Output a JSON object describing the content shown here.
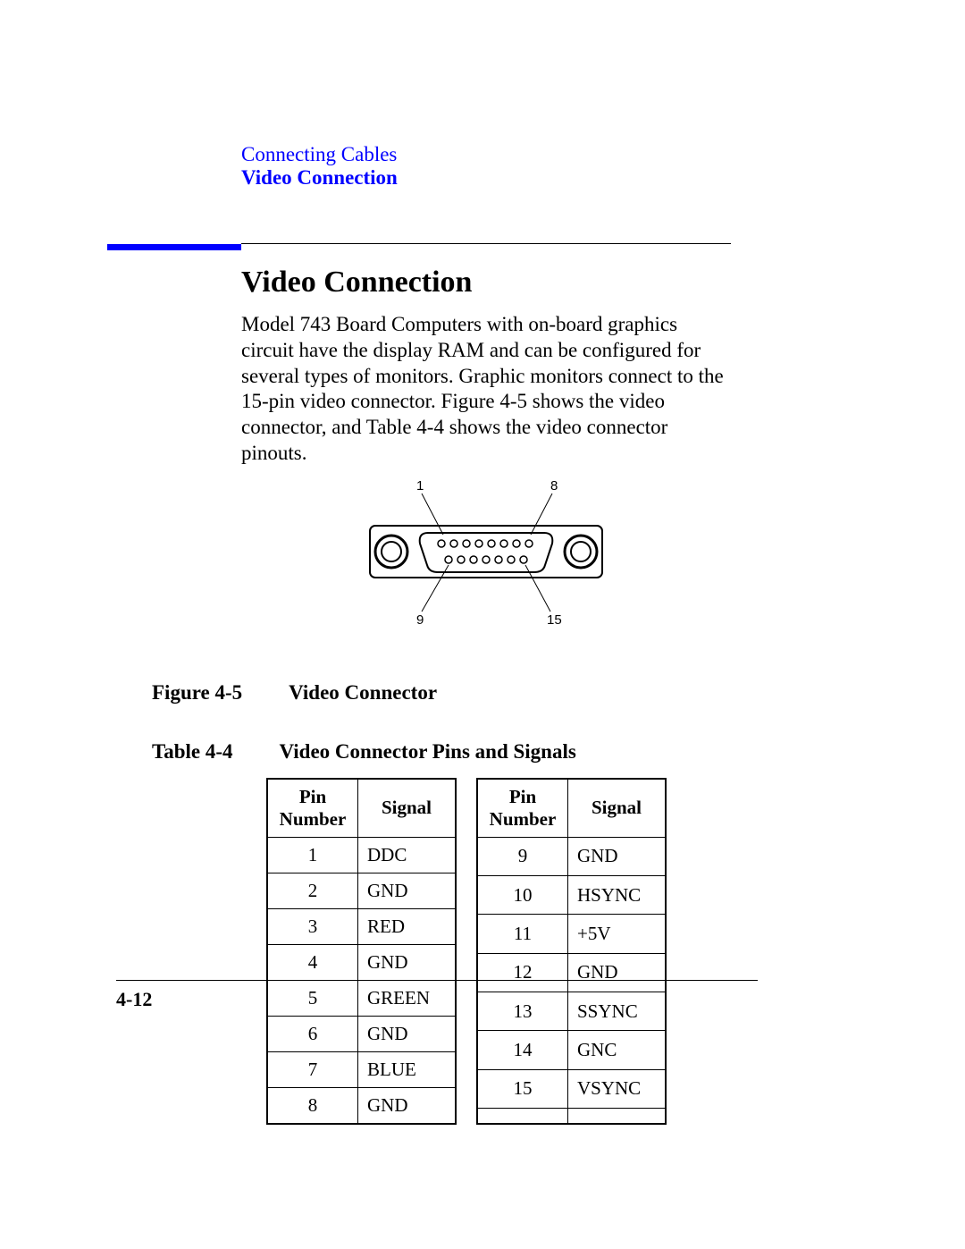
{
  "header": {
    "chapter": "Connecting Cables",
    "section": "Video Connection"
  },
  "title": "Video Connection",
  "paragraph": "Model 743 Board Computers with on-board graphics circuit have the display RAM and can be configured for several types of monitors. Graphic monitors connect to the 15-pin video connector. Figure 4-5 shows the video connector, and Table 4-4 shows the video connector pinouts.",
  "figure": {
    "label": "Figure 4-5",
    "caption": "Video Connector",
    "pin_labels": {
      "top_left": "1",
      "top_right": "8",
      "bottom_left": "9",
      "bottom_right": "15"
    }
  },
  "table": {
    "label": "Table 4-4",
    "caption": "Video Connector Pins and Signals",
    "headers": {
      "pin": "Pin Number",
      "signal": "Signal"
    },
    "left_rows": [
      {
        "pin": "1",
        "signal": "DDC"
      },
      {
        "pin": "2",
        "signal": "GND"
      },
      {
        "pin": "3",
        "signal": "RED"
      },
      {
        "pin": "4",
        "signal": "GND"
      },
      {
        "pin": "5",
        "signal": "GREEN"
      },
      {
        "pin": "6",
        "signal": "GND"
      },
      {
        "pin": "7",
        "signal": "BLUE"
      },
      {
        "pin": "8",
        "signal": "GND"
      }
    ],
    "right_rows": [
      {
        "pin": "9",
        "signal": "GND"
      },
      {
        "pin": "10",
        "signal": "HSYNC"
      },
      {
        "pin": "11",
        "signal": "+5V"
      },
      {
        "pin": "12",
        "signal": "GND"
      },
      {
        "pin": "13",
        "signal": "SSYNC"
      },
      {
        "pin": "14",
        "signal": "GNC"
      },
      {
        "pin": "15",
        "signal": "VSYNC"
      },
      {
        "pin": "",
        "signal": ""
      }
    ]
  },
  "page_number": "4-12"
}
